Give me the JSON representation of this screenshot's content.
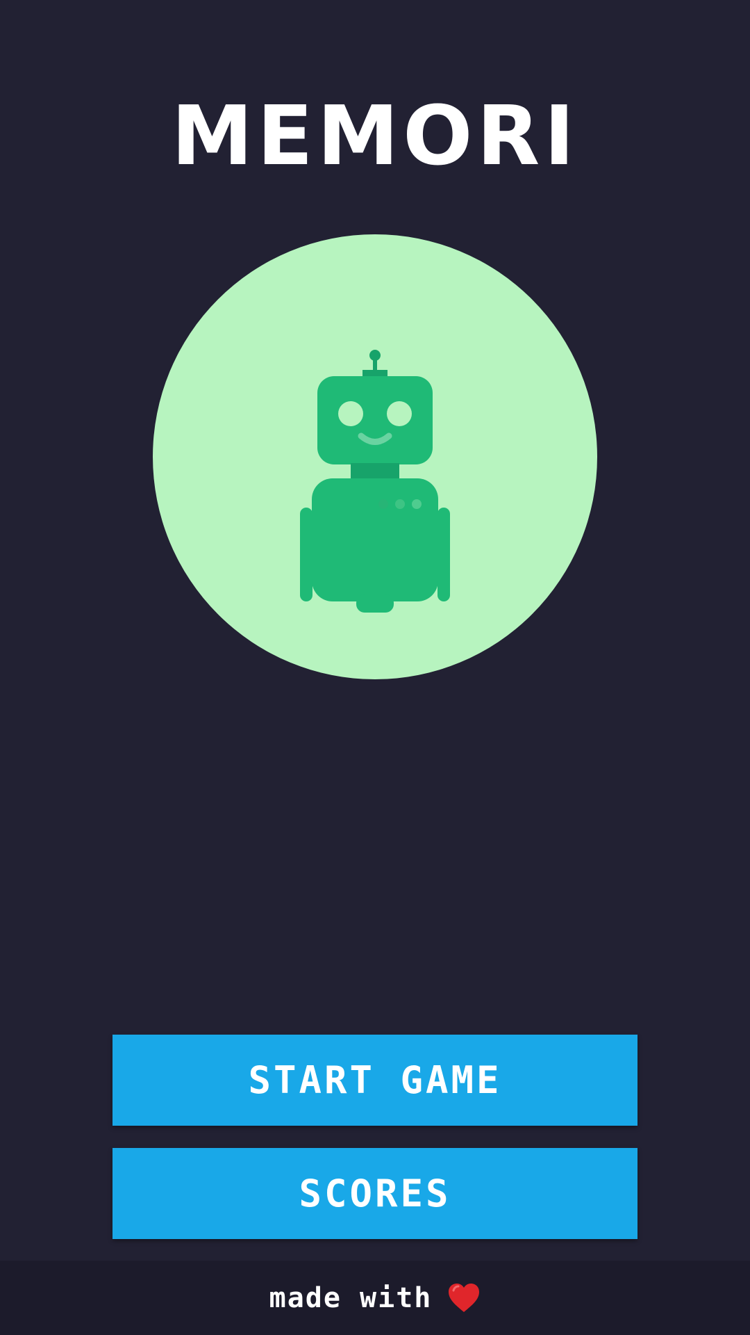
{
  "header": {
    "title": "MEMORI"
  },
  "hero": {
    "icon": "robot-icon",
    "background_color": "#b7f4bf",
    "robot_color": "#1fba76"
  },
  "menu": {
    "start_label": "START GAME",
    "scores_label": "SCORES",
    "button_color": "#19a8e8"
  },
  "footer": {
    "text": "made with",
    "icon": "heart-icon",
    "heart_color": "#e0262b"
  },
  "colors": {
    "background": "#222133",
    "footer_background": "#1c1b2b"
  }
}
